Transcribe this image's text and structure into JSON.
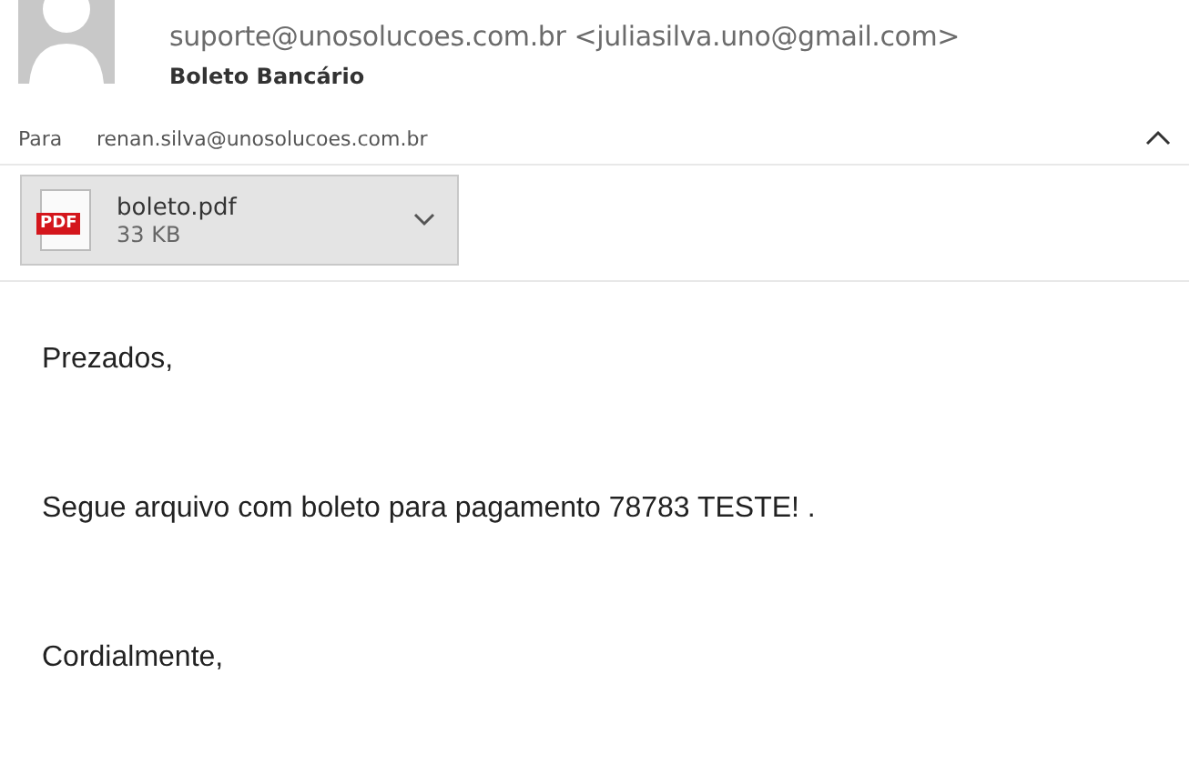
{
  "message": {
    "sender": "suporte@unosolucoes.com.br <juliasilva.uno@gmail.com>",
    "subject": "Boleto Bancário",
    "to_label": "Para",
    "to": "renan.silva@unosolucoes.com.br",
    "expanded": true
  },
  "attachment": {
    "badge": "PDF",
    "name": "boleto.pdf",
    "size": "33 KB"
  },
  "body": [
    "Prezados,",
    "Segue arquivo com boleto para pagamento 78783 TESTE! .",
    "Cordialmente,"
  ]
}
